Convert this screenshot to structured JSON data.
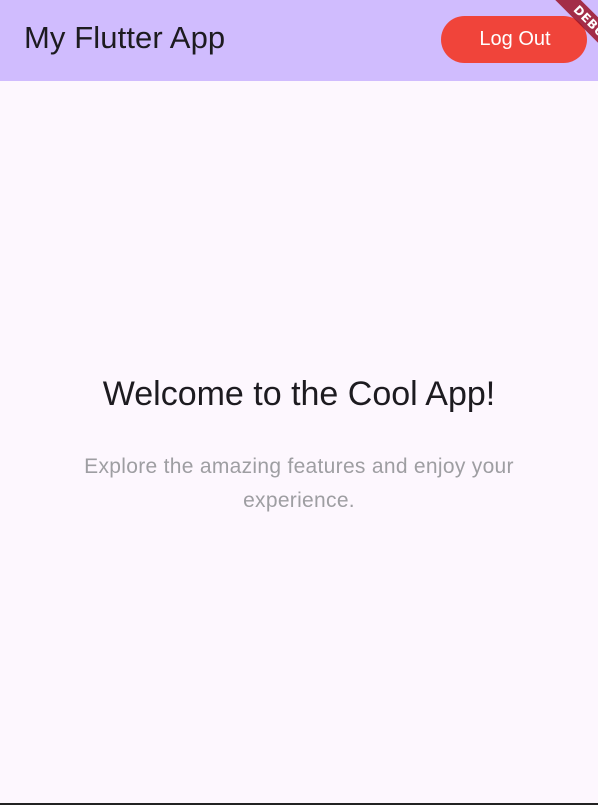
{
  "appbar": {
    "title": "My Flutter App",
    "logout_label": "Log Out",
    "debug_banner": "DEBUG"
  },
  "main": {
    "heading": "Welcome to the Cool App!",
    "subtitle": "Explore the amazing features and enjoy your experience."
  },
  "colors": {
    "appbar_bg": "#d0bcfe",
    "logout_bg": "#f0443a",
    "page_bg": "#fdf7fe",
    "subtitle_text": "#9e9ea2"
  }
}
